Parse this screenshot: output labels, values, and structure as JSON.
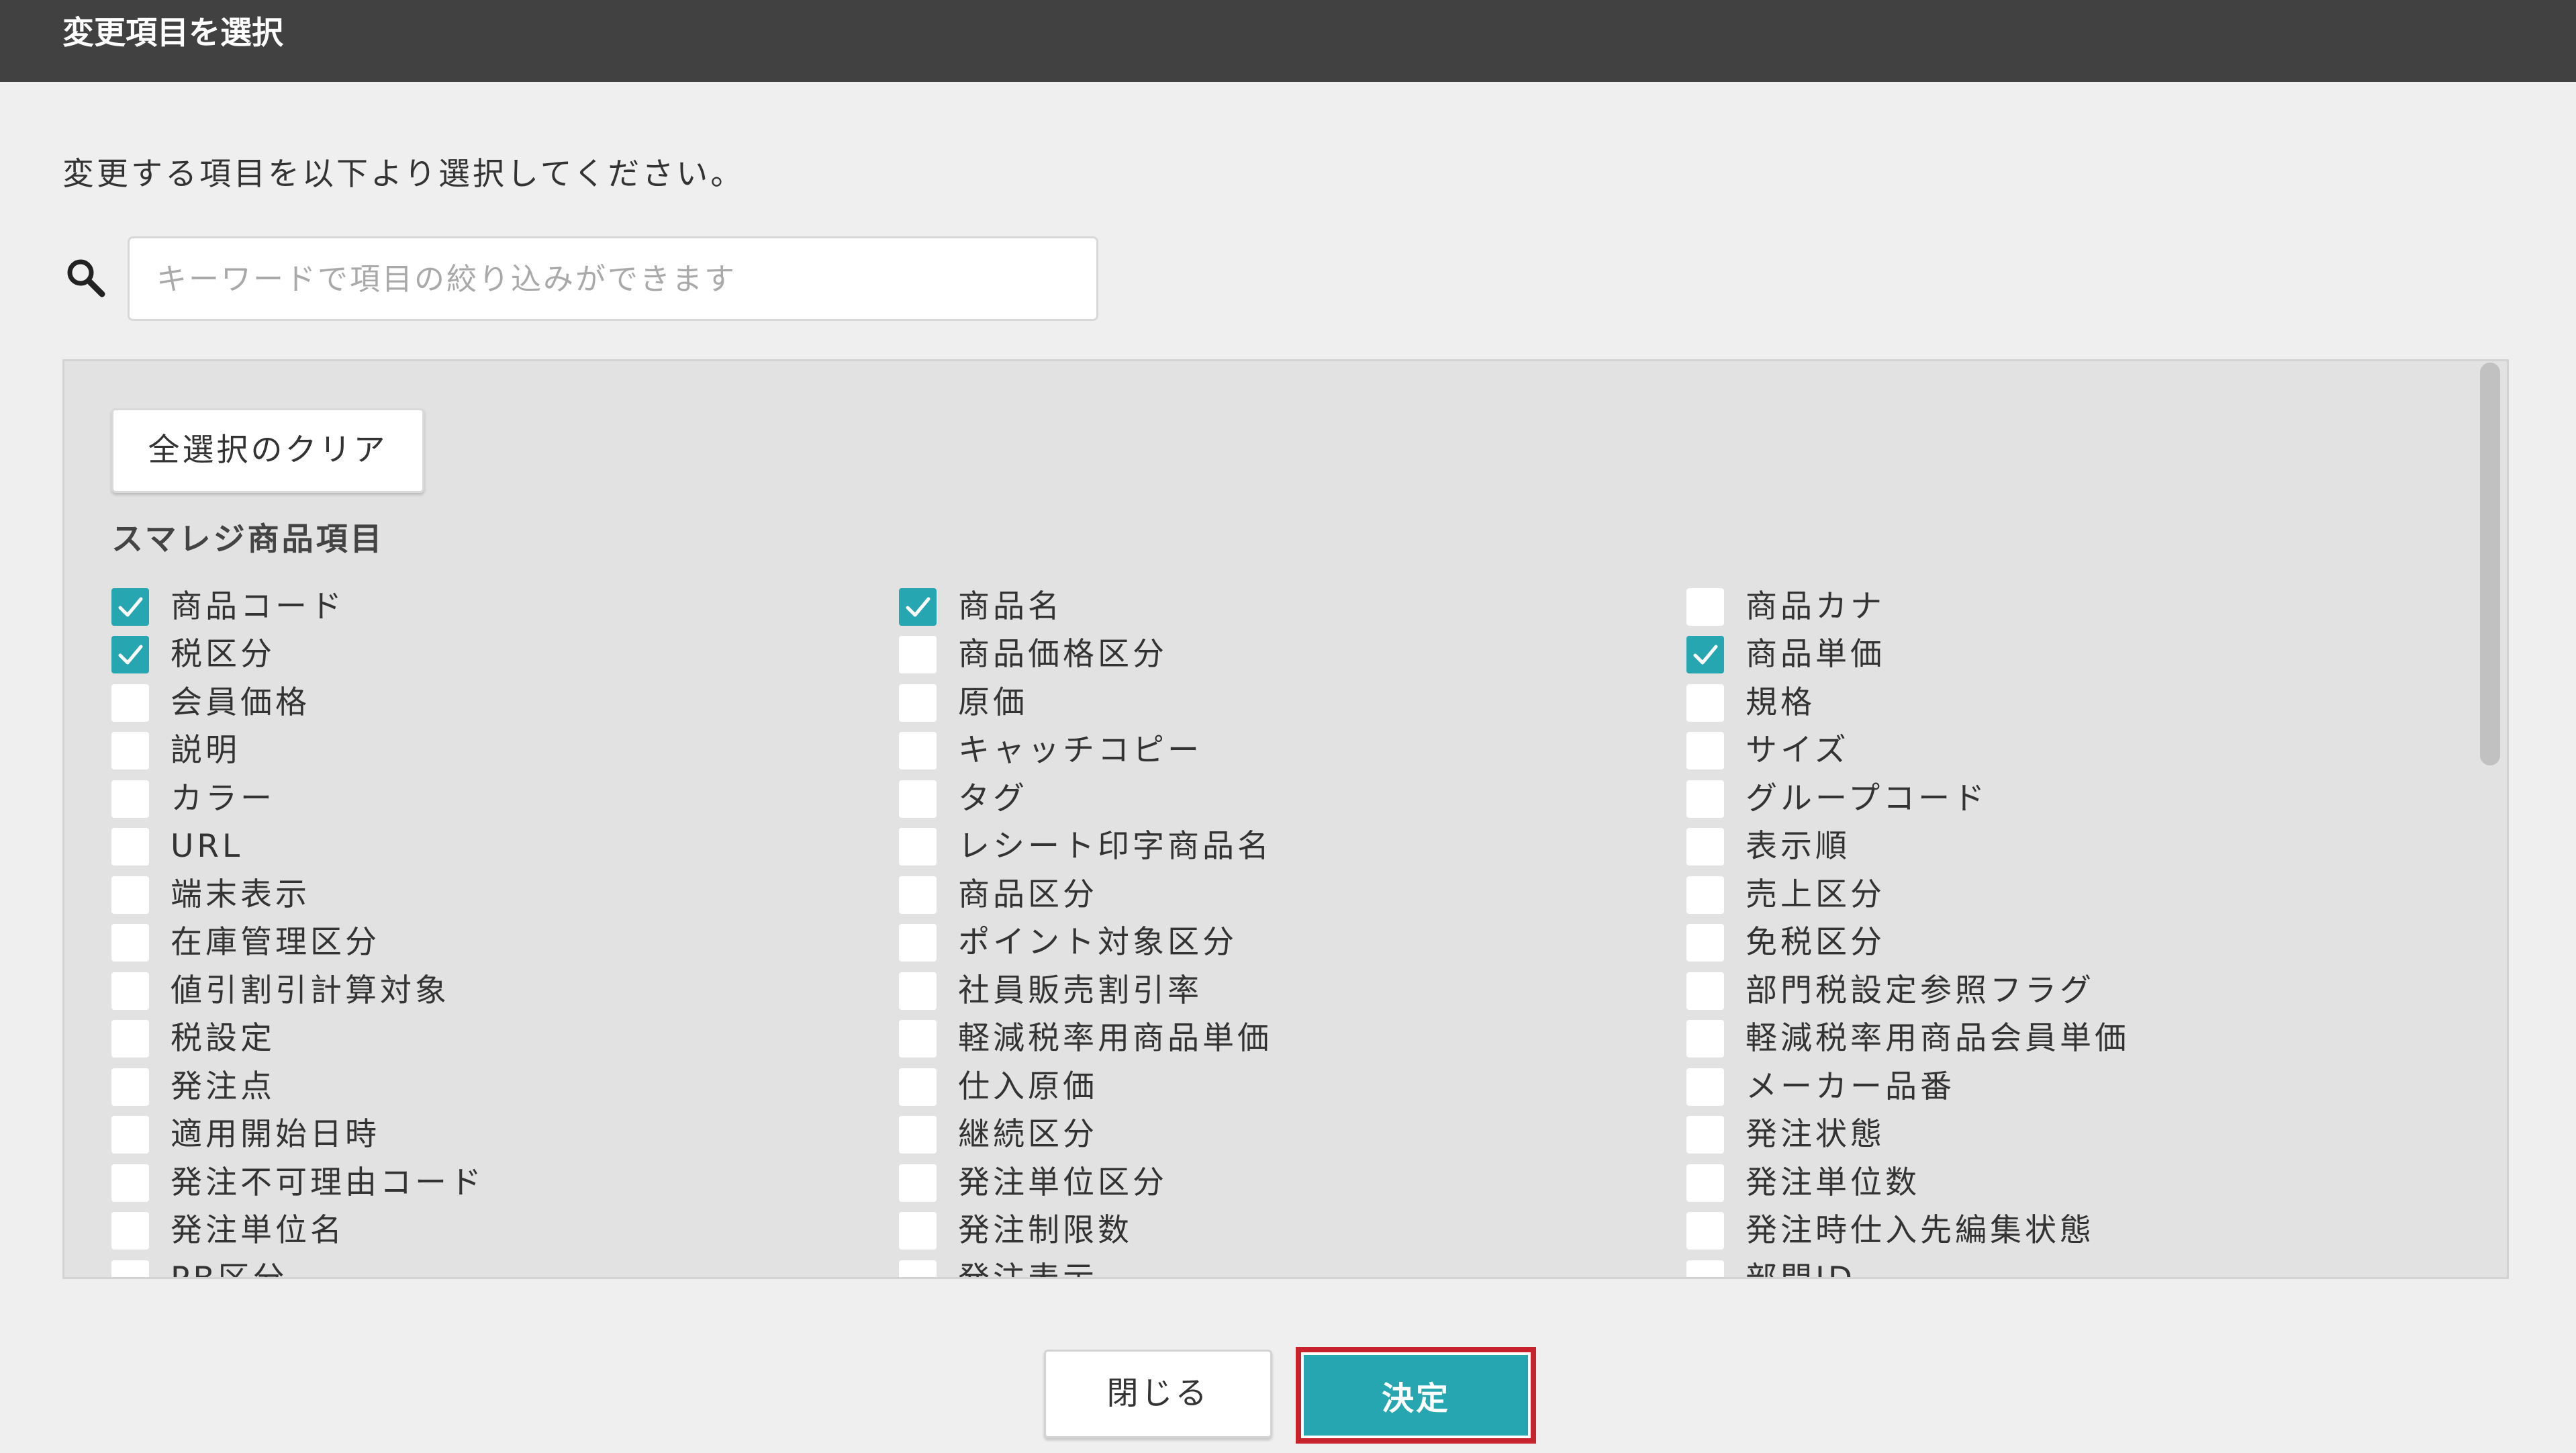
{
  "dialog": {
    "title": "変更項目を選択",
    "description": "変更する項目を以下より選択してください。",
    "search": {
      "value": "",
      "placeholder": "キーワードで項目の絞り込みができます",
      "icon": "search-icon"
    }
  },
  "list": {
    "clear_label": "全選択のクリア",
    "section_title": "スマレジ商品項目",
    "check_color": "#26a6b0",
    "items": [
      {
        "label": "商品コード",
        "checked": true
      },
      {
        "label": "商品名",
        "checked": true
      },
      {
        "label": "商品カナ",
        "checked": false
      },
      {
        "label": "税区分",
        "checked": true
      },
      {
        "label": "商品価格区分",
        "checked": false
      },
      {
        "label": "商品単価",
        "checked": true
      },
      {
        "label": "会員価格",
        "checked": false
      },
      {
        "label": "原価",
        "checked": false
      },
      {
        "label": "規格",
        "checked": false
      },
      {
        "label": "説明",
        "checked": false
      },
      {
        "label": "キャッチコピー",
        "checked": false
      },
      {
        "label": "サイズ",
        "checked": false
      },
      {
        "label": "カラー",
        "checked": false
      },
      {
        "label": "タグ",
        "checked": false
      },
      {
        "label": "グループコード",
        "checked": false
      },
      {
        "label": "URL",
        "checked": false
      },
      {
        "label": "レシート印字商品名",
        "checked": false
      },
      {
        "label": "表示順",
        "checked": false
      },
      {
        "label": "端末表示",
        "checked": false
      },
      {
        "label": "商品区分",
        "checked": false
      },
      {
        "label": "売上区分",
        "checked": false
      },
      {
        "label": "在庫管理区分",
        "checked": false
      },
      {
        "label": "ポイント対象区分",
        "checked": false
      },
      {
        "label": "免税区分",
        "checked": false
      },
      {
        "label": "値引割引計算対象",
        "checked": false
      },
      {
        "label": "社員販売割引率",
        "checked": false
      },
      {
        "label": "部門税設定参照フラグ",
        "checked": false
      },
      {
        "label": "税設定",
        "checked": false
      },
      {
        "label": "軽減税率用商品単価",
        "checked": false
      },
      {
        "label": "軽減税率用商品会員単価",
        "checked": false
      },
      {
        "label": "発注点",
        "checked": false
      },
      {
        "label": "仕入原価",
        "checked": false
      },
      {
        "label": "メーカー品番",
        "checked": false
      },
      {
        "label": "適用開始日時",
        "checked": false
      },
      {
        "label": "継続区分",
        "checked": false
      },
      {
        "label": "発注状態",
        "checked": false
      },
      {
        "label": "発注不可理由コード",
        "checked": false
      },
      {
        "label": "発注単位区分",
        "checked": false
      },
      {
        "label": "発注単位数",
        "checked": false
      },
      {
        "label": "発注単位名",
        "checked": false
      },
      {
        "label": "発注制限数",
        "checked": false
      },
      {
        "label": "発注時仕入先編集状態",
        "checked": false
      },
      {
        "label": "PB区分",
        "checked": false
      },
      {
        "label": "発注表示",
        "checked": false
      },
      {
        "label": "部門ID",
        "checked": false
      }
    ]
  },
  "footer": {
    "close_label": "閉じる",
    "ok_label": "決定",
    "ok_highlight_color": "#c8232c"
  }
}
